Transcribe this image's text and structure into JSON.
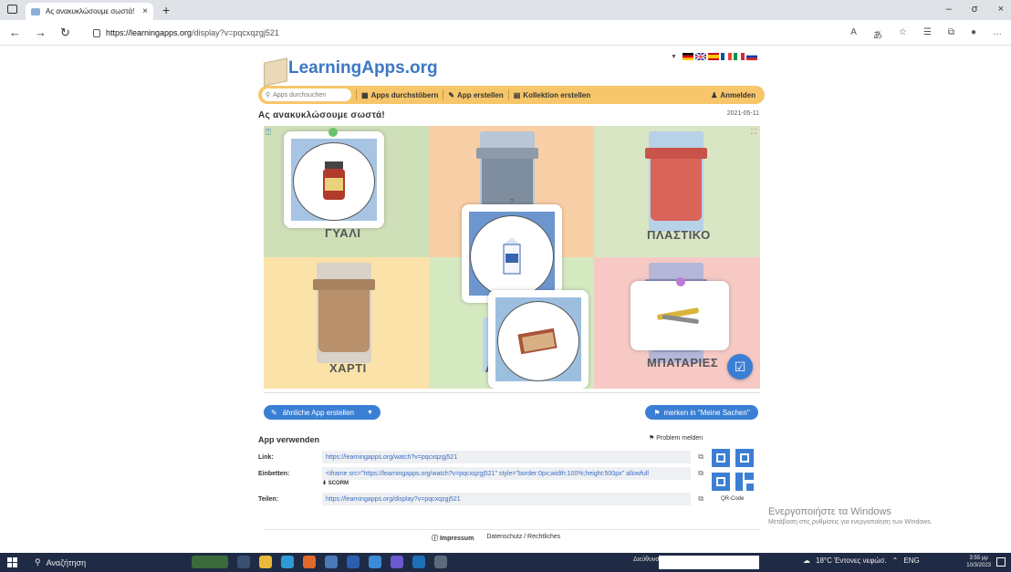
{
  "browser": {
    "tab_title": "Ας ανακυκλώσουμε σωστά!",
    "tab_close": "×",
    "new_tab": "+",
    "url_host": "https://learningapps.org",
    "url_path": "/display?v=pqcxqzgj521",
    "win_min": "–",
    "win_max": "σ",
    "win_close": "×"
  },
  "site": {
    "logo_text": "LearningApps.org",
    "search_placeholder": "Apps durchsuchen",
    "menu": {
      "browse": "Apps durchstöbern",
      "create_app": "App erstellen",
      "create_collection": "Kollektion erstellen",
      "login": "Anmelden"
    }
  },
  "app": {
    "title": "Ας ανακυκλώσουμε σωστά!",
    "date": "2021-05-11",
    "categories": {
      "glass": "ΓΥΑΛΙ",
      "plastic": "ΠΛΑΣΤΙΚΟ",
      "paper": "ΧΑΡΤΙ",
      "batteries": "ΜΠΑΤΑΡΙΕΣ",
      "partial": "Λ"
    },
    "question_mark": "?"
  },
  "actions": {
    "similar_app": "ähnliche App erstellen",
    "merken": "merken in \"Meine Sachen\""
  },
  "use": {
    "header": "App verwenden",
    "report": "Problem melden",
    "link_label": "Link:",
    "link_value": "https://learningapps.org/watch?v=pqcxqzgj521",
    "embed_label": "Einbetten:",
    "embed_value": "<iframe src=\"https://learningapps.org/watch?v=pqcxqzgj521\" style=\"border:0px;width:100%;height:500px\" allowfull",
    "scorm": "SCORM",
    "share_label": "Teilen:",
    "share_value": "https://learningapps.org/display?v=pqcxqzgj521",
    "qr_label": "QR-Code"
  },
  "footer": {
    "impressum": "Impressum",
    "datenschutz": "Datenschutz / Rechtliches"
  },
  "watermark": {
    "line1": "Ενεργοποιήστε τα Windows",
    "line2": "Μετάβαση στις ρυθμίσεις για ενεργοποίηση των Windows."
  },
  "taskbar": {
    "search": "Αναζήτηση",
    "address": "Διεύθυνση",
    "weather": "18°C Έντονες νεφώσ.",
    "lang": "ENG",
    "time": "3:55 μμ",
    "date": "10/3/2023"
  },
  "colors": {
    "accent": "#3b7fd4",
    "menubar": "#f7c66b",
    "quad_glass": "#cfe0b8",
    "quad_mid_top": "#f8cfa6",
    "quad_plastic": "#d9e6c4",
    "quad_paper": "#fbe2a8",
    "quad_mid_bottom": "#d5e9c0",
    "quad_batteries": "#f6c9c4"
  }
}
